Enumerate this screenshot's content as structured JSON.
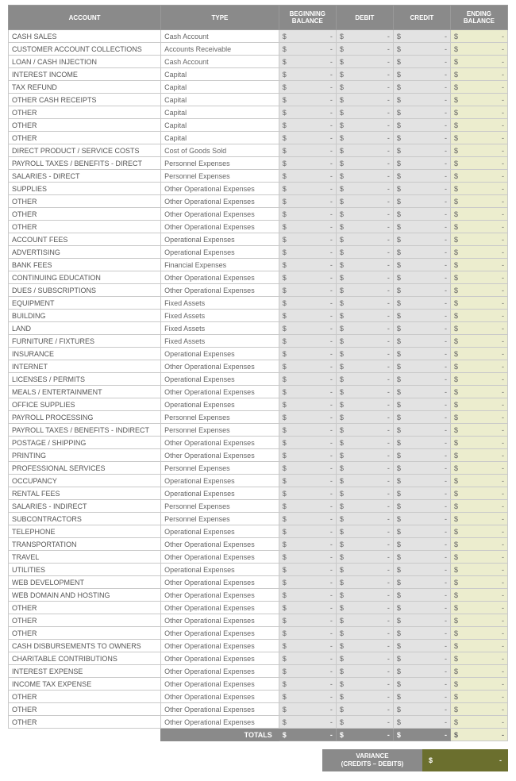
{
  "header": {
    "account": "ACCOUNT",
    "type": "TYPE",
    "begin": "BEGINNING BALANCE",
    "debit": "DEBIT",
    "credit": "CREDIT",
    "end": "ENDING BALANCE"
  },
  "currency": "$",
  "empty": "-",
  "totals_label": "TOTALS",
  "totals": {
    "begin": "-",
    "debit": "-",
    "credit": "-",
    "end": "-"
  },
  "variance": {
    "label": "VARIANCE\n(CREDITS – DEBITS)",
    "currency": "$",
    "value": "-"
  },
  "rows": [
    {
      "account": "CASH SALES",
      "type": "Cash Account"
    },
    {
      "account": "CUSTOMER ACCOUNT COLLECTIONS",
      "type": "Accounts Receivable"
    },
    {
      "account": "LOAN / CASH INJECTION",
      "type": "Cash Account"
    },
    {
      "account": "INTEREST INCOME",
      "type": "Capital"
    },
    {
      "account": "TAX REFUND",
      "type": "Capital"
    },
    {
      "account": "OTHER CASH RECEIPTS",
      "type": "Capital"
    },
    {
      "account": "OTHER",
      "type": "Capital"
    },
    {
      "account": "OTHER",
      "type": "Capital"
    },
    {
      "account": "OTHER",
      "type": "Capital"
    },
    {
      "account": "DIRECT PRODUCT / SERVICE COSTS",
      "type": "Cost of Goods Sold"
    },
    {
      "account": "PAYROLL TAXES / BENEFITS - DIRECT",
      "type": "Personnel Expenses"
    },
    {
      "account": "SALARIES - DIRECT",
      "type": "Personnel Expenses"
    },
    {
      "account": "SUPPLIES",
      "type": "Other Operational Expenses"
    },
    {
      "account": "OTHER",
      "type": "Other Operational Expenses"
    },
    {
      "account": "OTHER",
      "type": "Other Operational Expenses"
    },
    {
      "account": "OTHER",
      "type": "Other Operational Expenses"
    },
    {
      "account": "ACCOUNT FEES",
      "type": "Operational Expenses"
    },
    {
      "account": "ADVERTISING",
      "type": "Operational Expenses"
    },
    {
      "account": "BANK FEES",
      "type": "Financial Expenses"
    },
    {
      "account": "CONTINUING EDUCATION",
      "type": "Other Operational Expenses"
    },
    {
      "account": "DUES / SUBSCRIPTIONS",
      "type": "Other Operational Expenses"
    },
    {
      "account": "EQUIPMENT",
      "type": "Fixed Assets"
    },
    {
      "account": "BUILDING",
      "type": "Fixed Assets"
    },
    {
      "account": "LAND",
      "type": "Fixed Assets"
    },
    {
      "account": "FURNITURE / FIXTURES",
      "type": "Fixed Assets"
    },
    {
      "account": "INSURANCE",
      "type": "Operational Expenses"
    },
    {
      "account": "INTERNET",
      "type": "Other Operational Expenses"
    },
    {
      "account": "LICENSES / PERMITS",
      "type": "Operational Expenses"
    },
    {
      "account": "MEALS / ENTERTAINMENT",
      "type": "Other Operational Expenses"
    },
    {
      "account": "OFFICE SUPPLIES",
      "type": "Operational Expenses"
    },
    {
      "account": "PAYROLL PROCESSING",
      "type": "Personnel Expenses"
    },
    {
      "account": "PAYROLL TAXES / BENEFITS - INDIRECT",
      "type": "Personnel Expenses"
    },
    {
      "account": "POSTAGE / SHIPPING",
      "type": "Other Operational Expenses"
    },
    {
      "account": "PRINTING",
      "type": "Other Operational Expenses"
    },
    {
      "account": "PROFESSIONAL SERVICES",
      "type": "Personnel Expenses"
    },
    {
      "account": "OCCUPANCY",
      "type": "Operational Expenses"
    },
    {
      "account": "RENTAL FEES",
      "type": "Operational Expenses"
    },
    {
      "account": "SALARIES - INDIRECT",
      "type": "Personnel Expenses"
    },
    {
      "account": "SUBCONTRACTORS",
      "type": "Personnel Expenses"
    },
    {
      "account": "TELEPHONE",
      "type": "Operational Expenses"
    },
    {
      "account": "TRANSPORTATION",
      "type": "Other Operational Expenses"
    },
    {
      "account": "TRAVEL",
      "type": "Other Operational Expenses"
    },
    {
      "account": "UTILITIES",
      "type": "Operational Expenses"
    },
    {
      "account": "WEB DEVELOPMENT",
      "type": "Other Operational Expenses"
    },
    {
      "account": "WEB DOMAIN AND HOSTING",
      "type": "Other Operational Expenses"
    },
    {
      "account": "OTHER",
      "type": "Other Operational Expenses"
    },
    {
      "account": "OTHER",
      "type": "Other Operational Expenses"
    },
    {
      "account": "OTHER",
      "type": "Other Operational Expenses"
    },
    {
      "account": "CASH DISBURSEMENTS TO OWNERS",
      "type": "Other Operational Expenses"
    },
    {
      "account": "CHARITABLE CONTRIBUTIONS",
      "type": "Other Operational Expenses"
    },
    {
      "account": "INTEREST EXPENSE",
      "type": "Other Operational Expenses"
    },
    {
      "account": "INCOME TAX EXPENSE",
      "type": "Other Operational Expenses"
    },
    {
      "account": "OTHER",
      "type": "Other Operational Expenses"
    },
    {
      "account": "OTHER",
      "type": "Other Operational Expenses"
    },
    {
      "account": "OTHER",
      "type": "Other Operational Expenses"
    }
  ]
}
